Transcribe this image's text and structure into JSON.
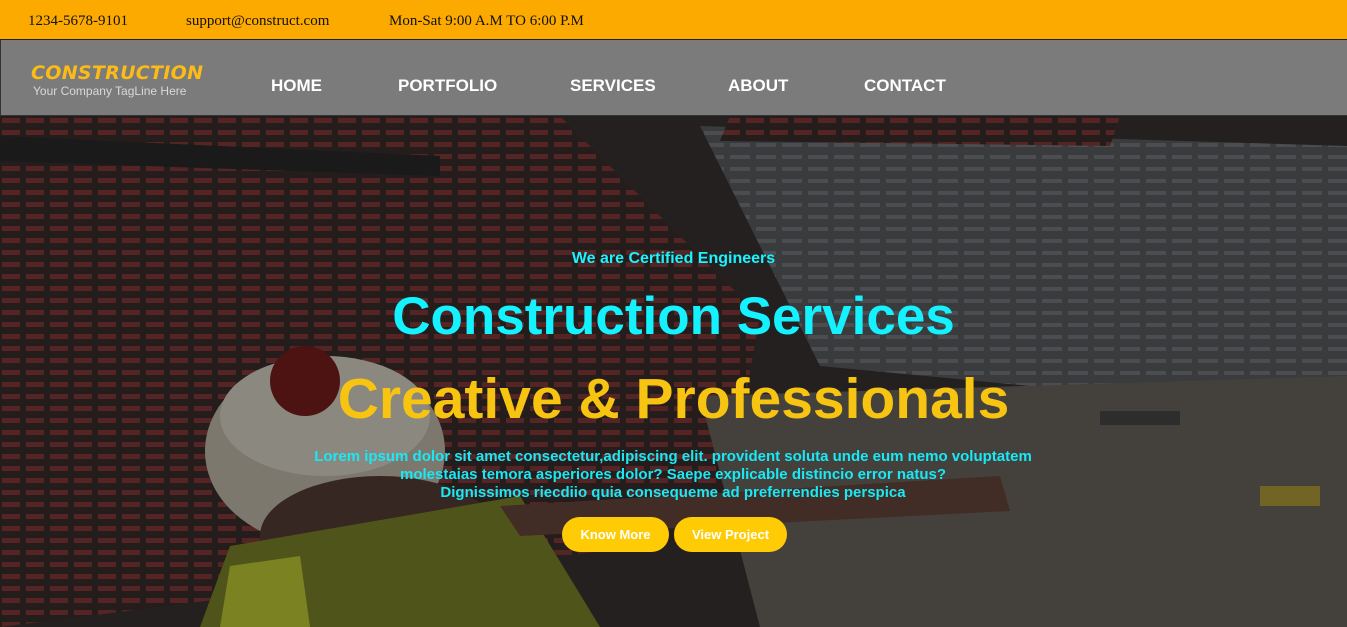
{
  "topbar": {
    "phone": "1234-5678-9101",
    "email": "support@construct.com",
    "hours": "Mon-Sat 9:00 A.M TO 6:00 P.M"
  },
  "header": {
    "logo_title": "CONSTRUCTION",
    "logo_tagline": "Your Company TagLine Here",
    "nav": [
      "HOME",
      "PORTFOLIO",
      "SERVICES",
      "ABOUT",
      "CONTACT"
    ]
  },
  "hero": {
    "tagline": "We are Certified Engineers",
    "headline1": "Construction Services",
    "headline2": "Creative & Professionals",
    "description_lines": [
      "Lorem ipsum dolor sit amet consectetur,adipiscing elit. provident soluta unde eum nemo voluptatem",
      "molestaias temora asperiores dolor? Saepe explicable distincio error natus?",
      "Dignissimos riecdiio quia consequeme ad preferrendies perspica"
    ],
    "buttons": {
      "know_more": "Know More",
      "view_project": "View Project"
    }
  },
  "colors": {
    "topbar_bg": "#fdaa00",
    "nav_bg": "#7b7b7b",
    "cyan_text": "#14f1ff",
    "gold_text": "#f6c411",
    "button_bg": "#ffcb05"
  }
}
